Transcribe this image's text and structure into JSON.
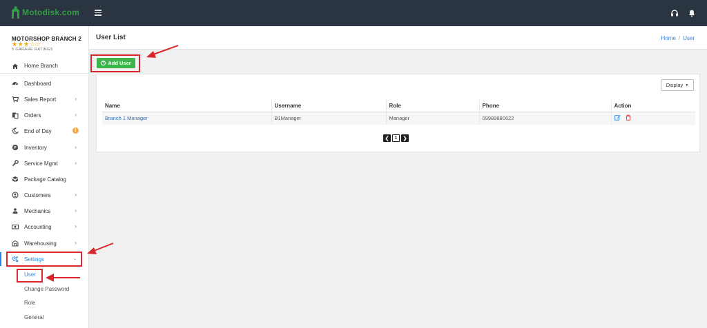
{
  "app": {
    "logo_text": "Motodisk.com"
  },
  "sidebar": {
    "branch_name": "MOTORSHOP BRANCH 2",
    "stars": "★★★☆☆",
    "rating_label": "5 GARAHE RATINGS",
    "home_branch": "Home Branch",
    "items": [
      {
        "label": "Dashboard",
        "icon": "dashboard-icon"
      },
      {
        "label": "Sales Report",
        "icon": "cart-icon"
      },
      {
        "label": "Orders",
        "icon": "orders-icon"
      },
      {
        "label": "End of Day",
        "icon": "moon-icon",
        "badge": "!"
      },
      {
        "label": "Inventory",
        "icon": "inventory-icon"
      },
      {
        "label": "Service Mgmt",
        "icon": "wrench-icon"
      },
      {
        "label": "Package Catalog",
        "icon": "package-icon"
      },
      {
        "label": "Customers",
        "icon": "user-circle-icon"
      },
      {
        "label": "Mechanics",
        "icon": "mechanic-icon"
      },
      {
        "label": "Accounting",
        "icon": "money-icon"
      },
      {
        "label": "Warehousing",
        "icon": "warehouse-icon"
      },
      {
        "label": "Settings",
        "icon": "gears-icon"
      }
    ],
    "settings_sub": [
      "User",
      "Change Password",
      "Role",
      "General"
    ]
  },
  "header": {
    "title": "User List",
    "breadcrumb": [
      "Home",
      "User"
    ]
  },
  "toolbar": {
    "add_user_label": "Add User",
    "display_label": "Display"
  },
  "table": {
    "columns": [
      "Name",
      "Username",
      "Role",
      "Phone",
      "Action"
    ],
    "rows": [
      {
        "name": "Branch 1 Manager",
        "username": "B1Manager",
        "role": "Manager",
        "phone": "09989880622"
      }
    ]
  },
  "pagination": {
    "current_page": "1"
  },
  "colors": {
    "topbar": "#2b3441",
    "accent": "#1e88e5",
    "add_button": "#3db54a",
    "annotation": "#d8262a"
  }
}
